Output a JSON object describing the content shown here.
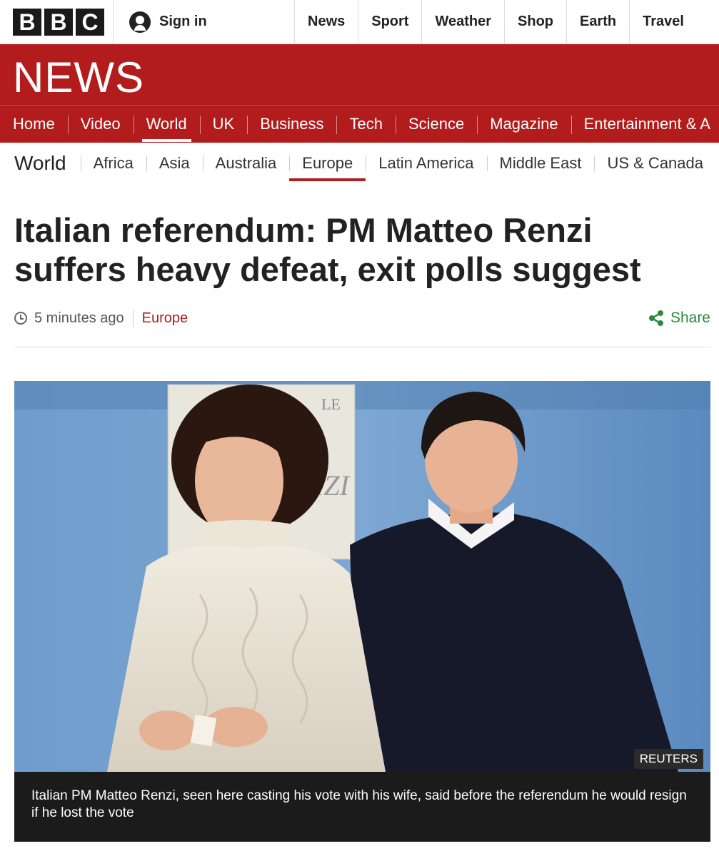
{
  "brand": {
    "letters": [
      "B",
      "B",
      "C"
    ],
    "signin_label": "Sign in"
  },
  "topnav": {
    "items": [
      "News",
      "Sport",
      "Weather",
      "Shop",
      "Earth",
      "Travel"
    ]
  },
  "banner": {
    "title": "NEWS",
    "color": "#b31c1c"
  },
  "section_nav": {
    "items": [
      "Home",
      "Video",
      "World",
      "UK",
      "Business",
      "Tech",
      "Science",
      "Magazine",
      "Entertainment & A"
    ],
    "active": "World"
  },
  "subnav": {
    "heading": "World",
    "items": [
      "Africa",
      "Asia",
      "Australia",
      "Europe",
      "Latin America",
      "Middle East",
      "US & Canada"
    ],
    "active": "Europe"
  },
  "article": {
    "headline": "Italian referendum: PM Matteo Renzi suffers heavy defeat, exit polls suggest",
    "time": "5 minutes ago",
    "section": "Europe",
    "share_label": "Share",
    "image_credit": "REUTERS",
    "caption": "Italian PM Matteo Renzi, seen here casting his vote with his wife, said before the referendum he would resign if he lost the vote",
    "poster_text_1": "LE",
    "poster_text_2": "IZI"
  },
  "colors": {
    "brand_red": "#b31c1c",
    "share_green": "#2a8a3c"
  },
  "icons": {
    "signin": "user-icon",
    "time": "clock-icon",
    "share": "share-icon"
  }
}
